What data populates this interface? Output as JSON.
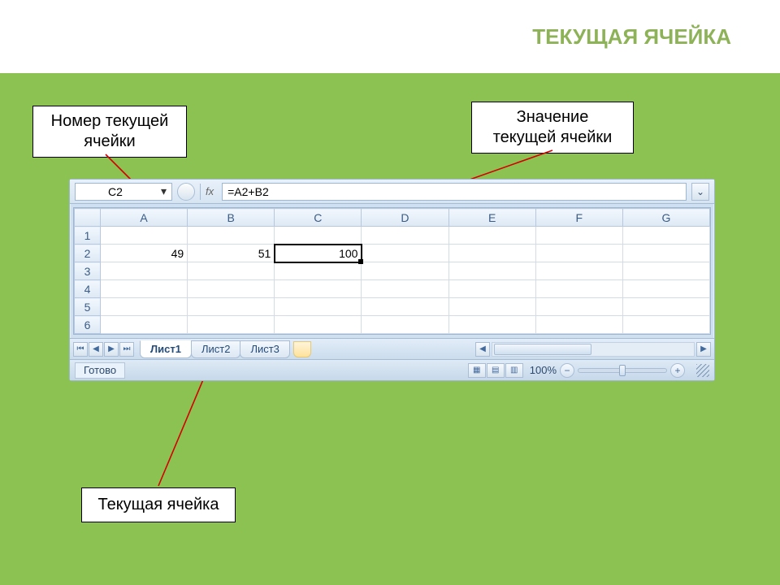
{
  "slide": {
    "title": "ТЕКУЩАЯ ЯЧЕЙКА",
    "labels": {
      "cellNumber": "Номер текущей ячейки",
      "cellValue": "Значение текущей ячейки",
      "currentCell": "Текущая ячейка"
    }
  },
  "excel": {
    "nameBox": "C2",
    "fxLabel": "fx",
    "formula": "=A2+B2",
    "columns": [
      "A",
      "B",
      "C",
      "D",
      "E",
      "F",
      "G"
    ],
    "rows": [
      "1",
      "2",
      "3",
      "4",
      "5",
      "6"
    ],
    "activeCol": "C",
    "activeRow": "2",
    "cells": {
      "A2": "49",
      "B2": "51",
      "C2": "100"
    },
    "sheets": [
      "Лист1",
      "Лист2",
      "Лист3"
    ],
    "status": "Готово",
    "zoom": "100%"
  }
}
